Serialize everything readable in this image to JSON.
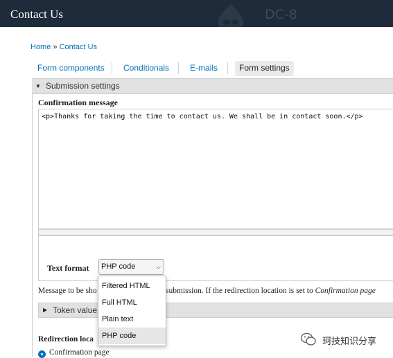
{
  "header": {
    "site_title": "Contact Us",
    "brand": "DC-8"
  },
  "breadcrumb": {
    "home": "Home",
    "separator": "»",
    "current": "Contact Us"
  },
  "tabs": [
    {
      "label": "Form components"
    },
    {
      "label": "Conditionals"
    },
    {
      "label": "E-mails"
    },
    {
      "label": "Form settings",
      "active": true
    }
  ],
  "submission_settings": {
    "legend": "Submission settings",
    "confirmation_label": "Confirmation message",
    "confirmation_value": "<p>Thanks for taking the time to contact us. We shall be in contact soon.</p>",
    "text_format_label": "Text format",
    "text_format_selected": "PHP code",
    "description_part1": "Message to be sho",
    "description_part2": "submission. If the redirection location is set to ",
    "description_em": "Confirmation page",
    "token_values_label": "Token value",
    "redirection_label": "Redirection loca",
    "radio_confirmation_label": "Confirmation page"
  },
  "dropdown": {
    "options": [
      "Filtered HTML",
      "Full HTML",
      "Plain text",
      "PHP code"
    ],
    "selected": "PHP code"
  },
  "watermark": {
    "text": "珂技知识分享"
  },
  "colors": {
    "header_bg": "#1d2b3a",
    "link": "#0071b3",
    "radio": "#0074bd"
  }
}
